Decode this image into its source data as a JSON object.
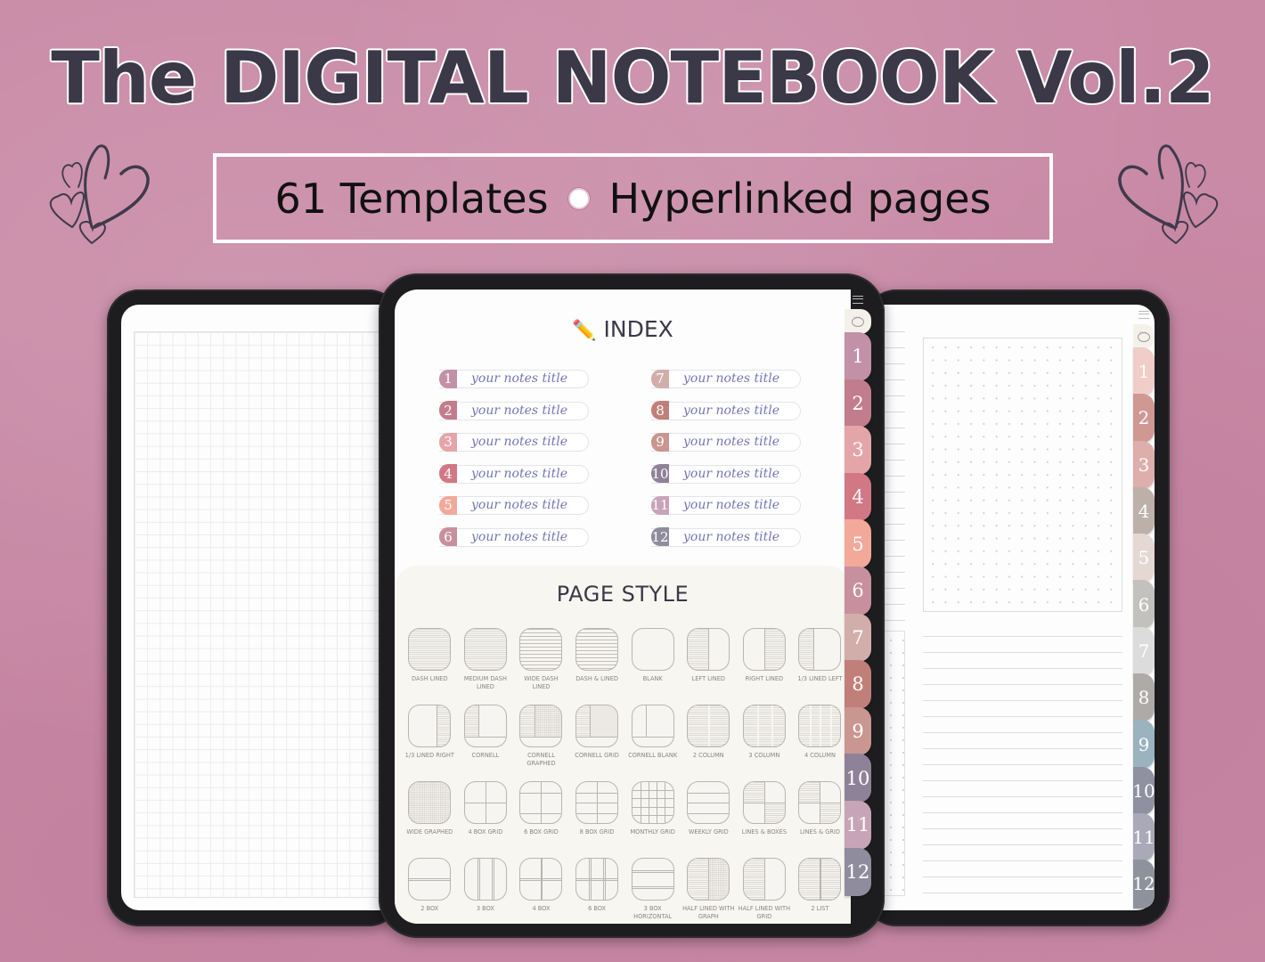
{
  "header": {
    "title": "The DIGITAL NOTEBOOK Vol.2",
    "subtitle_left": "61 Templates",
    "subtitle_right": "Hyperlinked pages"
  },
  "colors": {
    "background": "#c98aa6",
    "title_text": "#3b3848",
    "index_label": "#7476b4"
  },
  "index": {
    "title": "INDEX",
    "icon": "pencil-icon",
    "items": [
      {
        "num": "1",
        "label": "your notes title",
        "color": "#c291a8"
      },
      {
        "num": "2",
        "label": "your notes title",
        "color": "#c17d8b"
      },
      {
        "num": "3",
        "label": "your notes title",
        "color": "#e4a5a9"
      },
      {
        "num": "4",
        "label": "your notes title",
        "color": "#d27885"
      },
      {
        "num": "5",
        "label": "your notes title",
        "color": "#f2a99a"
      },
      {
        "num": "6",
        "label": "your notes title",
        "color": "#c8909f"
      },
      {
        "num": "7",
        "label": "your notes title",
        "color": "#d2aeaa"
      },
      {
        "num": "8",
        "label": "your notes title",
        "color": "#c08079"
      },
      {
        "num": "9",
        "label": "your notes title",
        "color": "#c99690"
      },
      {
        "num": "10",
        "label": "your notes title",
        "color": "#8e8299"
      },
      {
        "num": "11",
        "label": "your notes title",
        "color": "#c7a4b7"
      },
      {
        "num": "12",
        "label": "your notes title",
        "color": "#8f8c9e"
      }
    ]
  },
  "page_style": {
    "title": "PAGE STYLE",
    "items": [
      {
        "label": "DASH LINED",
        "pattern": "lines"
      },
      {
        "label": "MEDIUM DASH LINED",
        "pattern": "lines"
      },
      {
        "label": "WIDE DASH LINED",
        "pattern": "lines-sparse"
      },
      {
        "label": "DASH & LINED",
        "pattern": "lines-sparse"
      },
      {
        "label": "BLANK",
        "pattern": "blank"
      },
      {
        "label": "LEFT LINED",
        "pattern": "left-lined"
      },
      {
        "label": "RIGHT LINED",
        "pattern": "right-lined"
      },
      {
        "label": "1/3 LINED LEFT",
        "pattern": "third-left"
      },
      {
        "label": "1/3 LINED RIGHT",
        "pattern": "third-right"
      },
      {
        "label": "CORNELL",
        "pattern": "cornell"
      },
      {
        "label": "CORNELL GRAPHED",
        "pattern": "cornell-graph"
      },
      {
        "label": "CORNELL GRID",
        "pattern": "cornell-grid"
      },
      {
        "label": "CORNELL BLANK",
        "pattern": "cornell-blank"
      },
      {
        "label": "2 COLUMN",
        "pattern": "col2"
      },
      {
        "label": "3 COLUMN",
        "pattern": "col3"
      },
      {
        "label": "4 COLUMN",
        "pattern": "col4"
      },
      {
        "label": "WIDE GRAPHED",
        "pattern": "graph"
      },
      {
        "label": "4 BOX GRID",
        "pattern": "box4"
      },
      {
        "label": "6 BOX GRID",
        "pattern": "box6"
      },
      {
        "label": "8 BOX GRID",
        "pattern": "box8"
      },
      {
        "label": "MONTHLY GRID",
        "pattern": "monthly"
      },
      {
        "label": "WEEKLY GRID",
        "pattern": "weekly"
      },
      {
        "label": "LINES & BOXES",
        "pattern": "lines-boxes"
      },
      {
        "label": "LINES & GRID",
        "pattern": "lines-grid"
      },
      {
        "label": "2 BOX",
        "pattern": "b2"
      },
      {
        "label": "3 BOX",
        "pattern": "b3"
      },
      {
        "label": "4 BOX",
        "pattern": "b4"
      },
      {
        "label": "6 BOX",
        "pattern": "b6"
      },
      {
        "label": "3 BOX HORIZONTAL",
        "pattern": "b3h"
      },
      {
        "label": "HALF LINED WITH GRAPH",
        "pattern": "half-graph"
      },
      {
        "label": "HALF LINED WITH GRID",
        "pattern": "half-grid"
      },
      {
        "label": "2 LIST",
        "pattern": "list2"
      }
    ]
  },
  "tabs_center": [
    {
      "num": "1",
      "color": "#c291a8"
    },
    {
      "num": "2",
      "color": "#c17d8b"
    },
    {
      "num": "3",
      "color": "#e4a5a9"
    },
    {
      "num": "4",
      "color": "#d27885"
    },
    {
      "num": "5",
      "color": "#f2a99a"
    },
    {
      "num": "6",
      "color": "#c8909f"
    },
    {
      "num": "7",
      "color": "#d2aeaa"
    },
    {
      "num": "8",
      "color": "#c08079"
    },
    {
      "num": "9",
      "color": "#c99690"
    },
    {
      "num": "10",
      "color": "#8e8299"
    },
    {
      "num": "11",
      "color": "#c7a4b7"
    },
    {
      "num": "12",
      "color": "#8f8c9e"
    }
  ],
  "tabs_right": [
    {
      "num": "1",
      "color": "#f0cdc8"
    },
    {
      "num": "2",
      "color": "#cf9893"
    },
    {
      "num": "3",
      "color": "#ddaeab"
    },
    {
      "num": "4",
      "color": "#bdb0a8"
    },
    {
      "num": "5",
      "color": "#e5d7d2"
    },
    {
      "num": "6",
      "color": "#c3c1bd"
    },
    {
      "num": "7",
      "color": "#dcdcdc"
    },
    {
      "num": "8",
      "color": "#aeaaa8"
    },
    {
      "num": "9",
      "color": "#9bb2bf"
    },
    {
      "num": "10",
      "color": "#8f90a0"
    },
    {
      "num": "11",
      "color": "#a9a9b8"
    },
    {
      "num": "12",
      "color": "#8e929c"
    }
  ]
}
